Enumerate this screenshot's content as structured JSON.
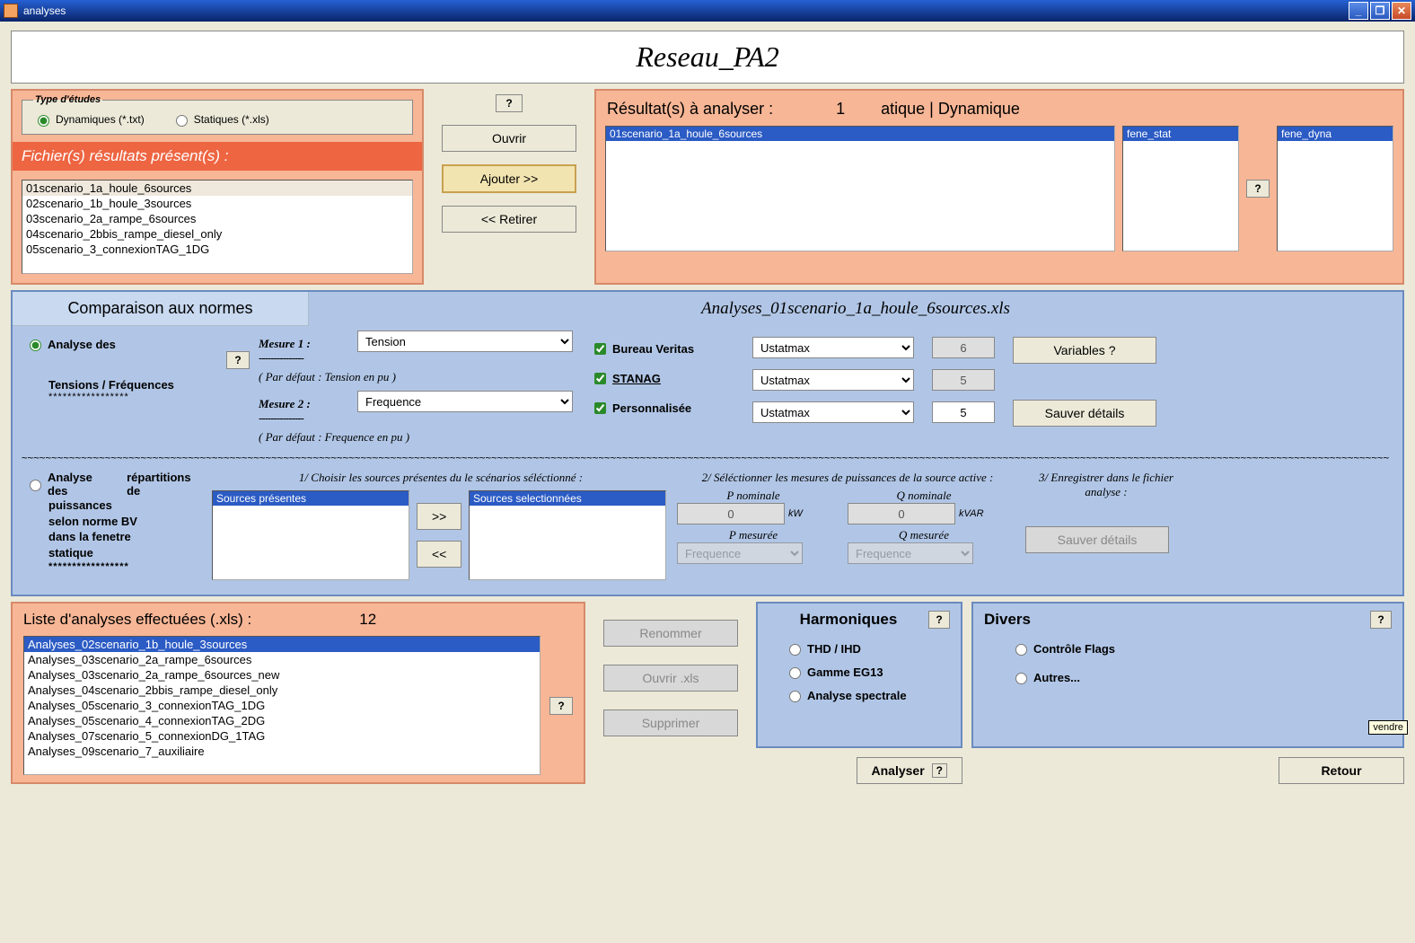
{
  "window": {
    "title": "analyses"
  },
  "header": {
    "title": "Reseau_PA2"
  },
  "study_types": {
    "legend": "Type d'études",
    "dynamic": "Dynamiques (*.txt)",
    "static": "Statiques (*.xls)"
  },
  "files_present": {
    "title": "Fichier(s) résultats présent(s) :",
    "items": [
      "01scenario_1a_houle_6sources",
      "02scenario_1b_houle_3sources",
      "03scenario_2a_rampe_6sources",
      "04scenario_2bbis_rampe_diesel_only",
      "05scenario_3_connexionTAG_1DG"
    ]
  },
  "middle_buttons": {
    "help": "?",
    "open": "Ouvrir",
    "add": "Ajouter >>",
    "remove": "<< Retirer"
  },
  "results": {
    "label": "Résultat(s) à analyser :",
    "count": "1",
    "tabs": "atique   |  Dynamique",
    "main_items": [
      "01scenario_1a_houle_6sources"
    ],
    "stat_items": [
      "fene_stat"
    ],
    "dyna_items": [
      "fene_dyna"
    ],
    "help": "?"
  },
  "comparison": {
    "tab": "Comparaison aux normes",
    "subtitle": "Analyses_01scenario_1a_houle_6sources.xls",
    "analyse_radio": "Analyse des",
    "tf_label": "Tensions / Fréquences",
    "help": "?",
    "mesure1": "Mesure 1 :",
    "mesure1_default": "( Par défaut : Tension en pu )",
    "mesure1_value": "Tension",
    "mesure2": "Mesure 2 :",
    "mesure2_default": "( Par défaut : Frequence en pu )",
    "mesure2_value": "Frequence",
    "norm_bv": "Bureau Veritas",
    "norm_stanag": "STANAG",
    "norm_perso": "Personnalisée",
    "stat_bv": "Ustatmax",
    "stat_stanag": "Ustatmax",
    "stat_perso": "Ustatmax",
    "val_bv": "6",
    "val_stanag": "5",
    "val_perso": "5",
    "variables_btn": "Variables ?",
    "save_btn": "Sauver détails"
  },
  "power_analysis": {
    "radio": "Analyse des",
    "label_right": "répartitions de",
    "sub1": "puissances",
    "sub2": "selon norme BV",
    "sub3": "dans la fenetre",
    "sub4": "statique",
    "step1": "1/  Choisir les sources présentes du le scénarios séléctionné :",
    "step2": "2/  Séléctionner les mesures de puissances de la source active :",
    "step3": "3/  Enregistrer dans le fichier analyse :",
    "present_header": "Sources présentes",
    "selected_header": "Sources selectionnées",
    "move_right": ">>",
    "move_left": "<<",
    "p_nom": "P nominale",
    "p_nom_unit": "kW",
    "p_nom_val": "0",
    "q_nom": "Q nominale",
    "q_nom_unit": "kVAR",
    "q_nom_val": "0",
    "p_mes": "P mesurée",
    "q_mes": "Q mesurée",
    "p_mes_val": "Frequence",
    "q_mes_val": "Frequence",
    "save_btn": "Sauver détails"
  },
  "done_list": {
    "title": "Liste d'analyses effectuées (.xls) :",
    "count": "12",
    "help": "?",
    "items": [
      "Analyses_02scenario_1b_houle_3sources",
      "Analyses_03scenario_2a_rampe_6sources",
      "Analyses_03scenario_2a_rampe_6sources_new",
      "Analyses_04scenario_2bbis_rampe_diesel_only",
      "Analyses_05scenario_3_connexionTAG_1DG",
      "Analyses_05scenario_4_connexionTAG_2DG",
      "Analyses_07scenario_5_connexionDG_1TAG",
      "Analyses_09scenario_7_auxiliaire"
    ]
  },
  "done_buttons": {
    "rename": "Renommer",
    "open": "Ouvrir .xls",
    "delete": "Supprimer"
  },
  "harmonics": {
    "title": "Harmoniques",
    "help": "?",
    "opt1": "THD / IHD",
    "opt2": "Gamme EG13",
    "opt3": "Analyse spectrale",
    "analyse_btn": "Analyser",
    "analyse_help": "?"
  },
  "divers": {
    "title": "Divers",
    "help": "?",
    "opt1": "Contrôle Flags",
    "opt2": "Autres...",
    "retour": "Retour"
  },
  "tooltip": "vendre"
}
